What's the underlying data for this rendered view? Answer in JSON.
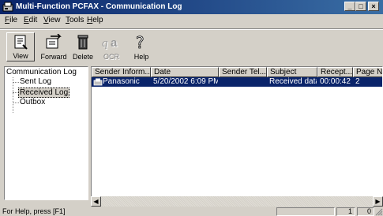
{
  "window": {
    "title": "Multi-Function PCFAX - Communication Log",
    "controls": {
      "minimize": "_",
      "maximize": "□",
      "close": "×"
    }
  },
  "menu": [
    {
      "label": "File",
      "key": "F",
      "rest": "ile"
    },
    {
      "label": "Edit",
      "key": "E",
      "rest": "dit"
    },
    {
      "label": "View",
      "key": "V",
      "rest": "iew"
    },
    {
      "label": "Tools",
      "key": "T",
      "rest": "ools"
    },
    {
      "label": "Help",
      "key": "H",
      "rest": "elp"
    }
  ],
  "toolbar": {
    "view_label": "View",
    "forward_label": "Forward",
    "delete_label": "Delete",
    "ocr_label": "OCR",
    "help_label": "Help"
  },
  "tree": {
    "root": "Communication Log",
    "children": [
      "Sent Log",
      "Received Log",
      "Outbox"
    ],
    "selected": "Received Log"
  },
  "list": {
    "columns": [
      "Sender Inform...",
      "Date",
      "Sender Tel...",
      "Subject",
      "Recept...",
      "Page Nu"
    ],
    "rows": [
      {
        "sender": "Panasonic",
        "date": "5/20/2002 6:09 PM",
        "tel": "",
        "subject": "Received data",
        "reception": "00:00:42",
        "pages": "2"
      }
    ]
  },
  "status": {
    "text": "For Help, press [F1]",
    "panel_a": "1",
    "panel_b": "0"
  }
}
